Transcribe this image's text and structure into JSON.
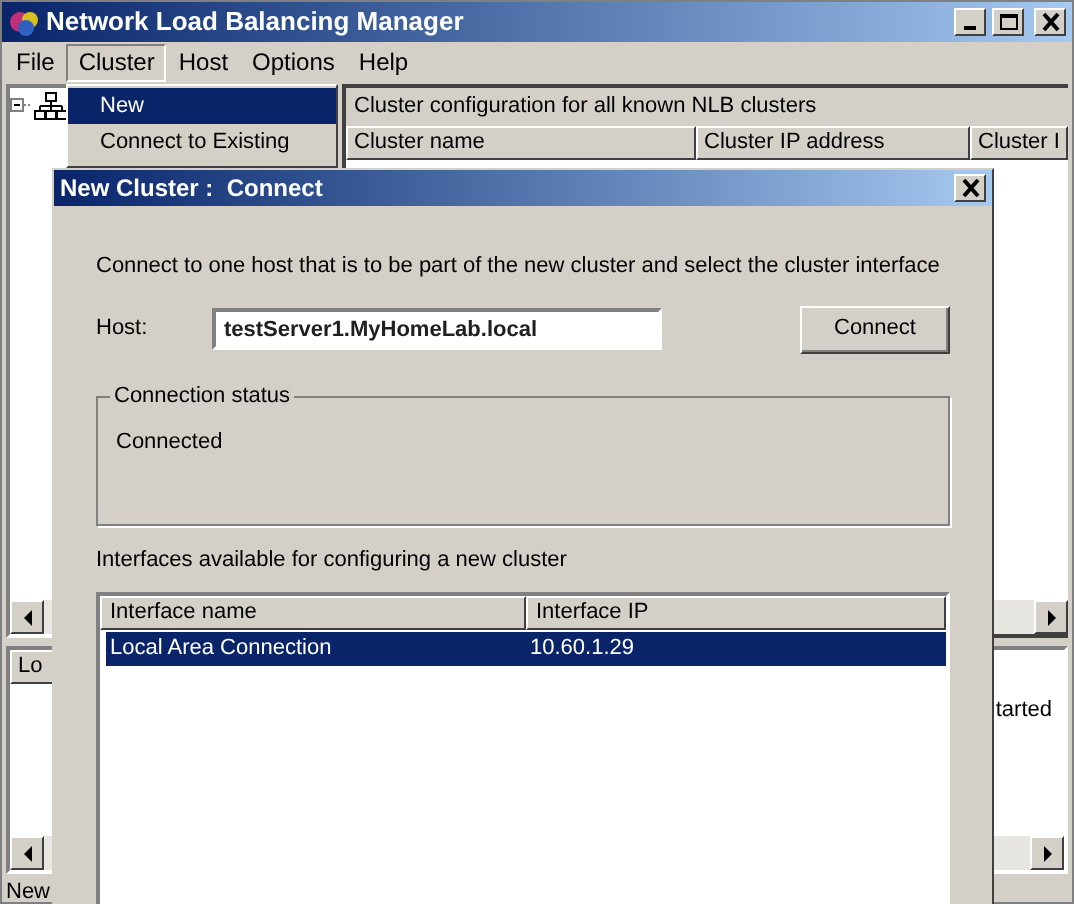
{
  "window": {
    "title": "Network Load Balancing Manager"
  },
  "menu_bar": [
    {
      "label": "File",
      "selected": false
    },
    {
      "label": "Cluster",
      "selected": true
    },
    {
      "label": "Host",
      "selected": false
    },
    {
      "label": "Options",
      "selected": false
    },
    {
      "label": "Help",
      "selected": false
    }
  ],
  "cluster_menu": [
    {
      "label": "New",
      "selected": true
    },
    {
      "label": "Connect to Existing",
      "selected": false
    }
  ],
  "cluster_list": {
    "caption": "Cluster configuration for all known NLB clusters",
    "columns": [
      "Cluster name",
      "Cluster IP address",
      "Cluster I"
    ]
  },
  "log_pane": {
    "columns": [
      "Lo"
    ],
    "text": "tarted"
  },
  "status_bar": "New",
  "dialog": {
    "title": "New Cluster :  Connect",
    "instruction": "Connect to one host that is to be part of the new cluster and select the cluster interface",
    "host_label": "Host:",
    "host_value": "testServer1.MyHomeLab.local",
    "connect_button": "Connect",
    "connection_status": {
      "legend": "Connection status",
      "text": "Connected"
    },
    "interfaces_label": "Interfaces available for configuring a new cluster",
    "interfaces": {
      "columns": [
        "Interface name",
        "Interface IP"
      ],
      "rows": [
        {
          "cells": [
            "Local Area Connection",
            "10.60.1.29"
          ],
          "selected": true
        }
      ]
    }
  }
}
